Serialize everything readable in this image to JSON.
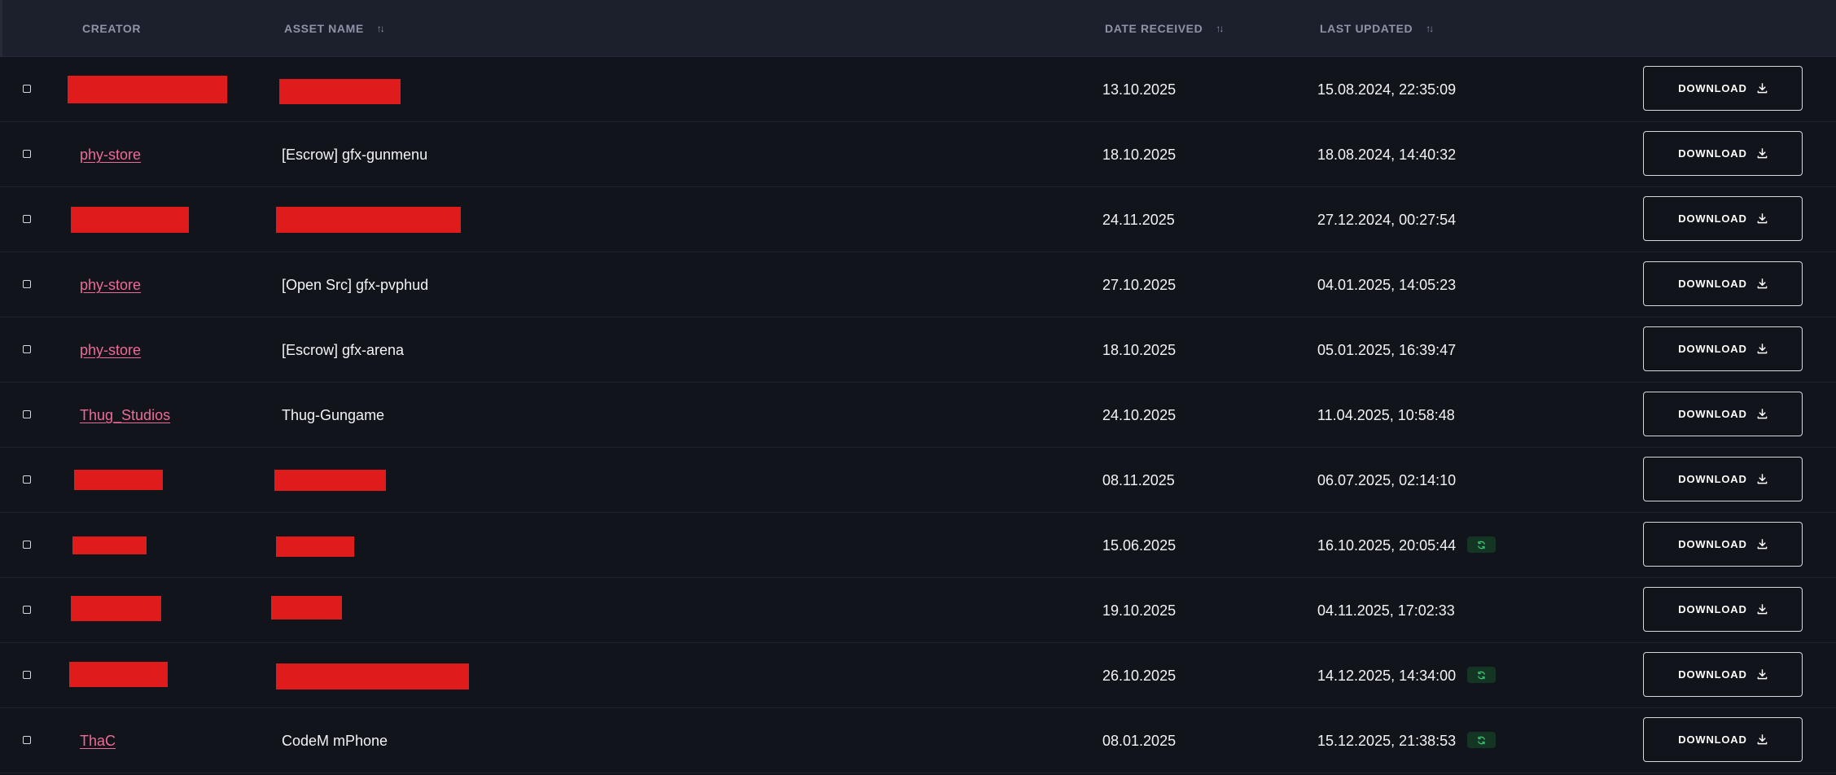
{
  "columns": {
    "creator": "CREATOR",
    "asset_name": "ASSET NAME",
    "date_received": "DATE RECEIVED",
    "last_updated": "LAST UPDATED"
  },
  "icons": {
    "sort": "sort-arrows-icon",
    "download": "download-icon",
    "update": "refresh-icon"
  },
  "colors": {
    "creator_link": "#ee6b98",
    "redaction": "#e01b1b",
    "update_badge": "#143524",
    "update_icon": "#3cc56f"
  },
  "download_label": "DOWNLOAD",
  "rows": [
    {
      "creator": "",
      "creator_redacted": true,
      "asset": "",
      "asset_redacted": true,
      "date_received": "13.10.2025",
      "last_updated": "15.08.2024, 22:35:09",
      "has_update": false
    },
    {
      "creator": "phy-store",
      "creator_redacted": false,
      "asset": "[Escrow] gfx-gunmenu",
      "asset_redacted": false,
      "date_received": "18.10.2025",
      "last_updated": "18.08.2024, 14:40:32",
      "has_update": false
    },
    {
      "creator": "",
      "creator_redacted": true,
      "asset": "",
      "asset_redacted": true,
      "date_received": "24.11.2025",
      "last_updated": "27.12.2024, 00:27:54",
      "has_update": false
    },
    {
      "creator": "phy-store",
      "creator_redacted": false,
      "asset": "[Open Src] gfx-pvphud",
      "asset_redacted": false,
      "date_received": "27.10.2025",
      "last_updated": "04.01.2025, 14:05:23",
      "has_update": false
    },
    {
      "creator": "phy-store",
      "creator_redacted": false,
      "asset": "[Escrow] gfx-arena",
      "asset_redacted": false,
      "date_received": "18.10.2025",
      "last_updated": "05.01.2025, 16:39:47",
      "has_update": false
    },
    {
      "creator": "Thug_Studios",
      "creator_redacted": false,
      "asset": "Thug-Gungame",
      "asset_redacted": false,
      "date_received": "24.10.2025",
      "last_updated": "11.04.2025, 10:58:48",
      "has_update": false
    },
    {
      "creator": "",
      "creator_redacted": true,
      "asset": "",
      "asset_redacted": true,
      "date_received": "08.11.2025",
      "last_updated": "06.07.2025, 02:14:10",
      "has_update": false
    },
    {
      "creator": "",
      "creator_redacted": true,
      "asset": "",
      "asset_redacted": true,
      "date_received": "15.06.2025",
      "last_updated": "16.10.2025, 20:05:44",
      "has_update": true
    },
    {
      "creator": "",
      "creator_redacted": true,
      "asset": "",
      "asset_redacted": true,
      "date_received": "19.10.2025",
      "last_updated": "04.11.2025, 17:02:33",
      "has_update": false
    },
    {
      "creator": "",
      "creator_redacted": true,
      "asset": "",
      "asset_redacted": true,
      "date_received": "26.10.2025",
      "last_updated": "14.12.2025, 14:34:00",
      "has_update": true
    },
    {
      "creator": "ThaC",
      "creator_redacted": false,
      "asset": "CodeM mPhone",
      "asset_redacted": false,
      "date_received": "08.01.2025",
      "last_updated": "15.12.2025, 21:38:53",
      "has_update": true
    }
  ]
}
